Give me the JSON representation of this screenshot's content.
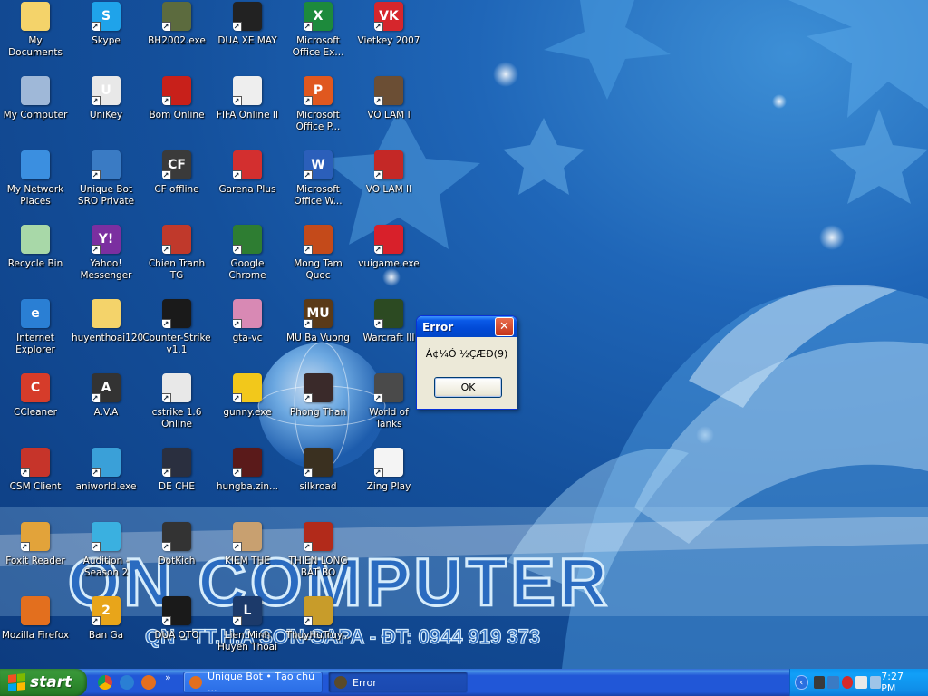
{
  "desktop": {
    "icons": [
      {
        "label": "My Documents",
        "name": "my-documents-icon",
        "glyph": "",
        "color": "#f4d36a",
        "shortcut": false
      },
      {
        "label": "Skype",
        "name": "skype-icon",
        "glyph": "S",
        "color": "#1fa3ea",
        "shortcut": true
      },
      {
        "label": "BH2002.exe",
        "name": "bh2002-icon",
        "glyph": "",
        "color": "#5c6b3e",
        "shortcut": true
      },
      {
        "label": "DUA XE MAY",
        "name": "dua-xe-may-icon",
        "glyph": "",
        "color": "#222222",
        "shortcut": true
      },
      {
        "label": "Microsoft Office Ex...",
        "name": "excel-icon",
        "glyph": "X",
        "color": "#1d8a3c",
        "shortcut": true
      },
      {
        "label": "Vietkey 2007",
        "name": "vietkey-icon",
        "glyph": "VK",
        "color": "#d6262c",
        "shortcut": true
      },
      {
        "label": "My Computer",
        "name": "my-computer-icon",
        "glyph": "",
        "color": "#9fb8d8",
        "shortcut": false
      },
      {
        "label": "UniKey",
        "name": "unikey-icon",
        "glyph": "U",
        "color": "#e8e8e8",
        "shortcut": true
      },
      {
        "label": "Bom Online",
        "name": "bom-online-icon",
        "glyph": "",
        "color": "#c8201a",
        "shortcut": true
      },
      {
        "label": "FIFA Online II",
        "name": "fifa-online-icon",
        "glyph": "",
        "color": "#eeeeee",
        "shortcut": true
      },
      {
        "label": "Microsoft Office P...",
        "name": "powerpoint-icon",
        "glyph": "P",
        "color": "#e0581f",
        "shortcut": true
      },
      {
        "label": "VO LAM I",
        "name": "vo-lam-1-icon",
        "glyph": "",
        "color": "#6b4e34",
        "shortcut": true
      },
      {
        "label": "My Network Places",
        "name": "network-places-icon",
        "glyph": "",
        "color": "#3b8fe0",
        "shortcut": false
      },
      {
        "label": "Unique Bot SRO Private",
        "name": "unique-bot-icon",
        "glyph": "",
        "color": "#3a7bc4",
        "shortcut": true
      },
      {
        "label": "CF offline",
        "name": "cf-offline-icon",
        "glyph": "CF",
        "color": "#3a3a3a",
        "shortcut": true
      },
      {
        "label": "Garena Plus",
        "name": "garena-plus-icon",
        "glyph": "",
        "color": "#d32f2f",
        "shortcut": true
      },
      {
        "label": "Microsoft Office W...",
        "name": "word-icon",
        "glyph": "W",
        "color": "#2b5fba",
        "shortcut": true
      },
      {
        "label": "VO LAM II",
        "name": "vo-lam-2-icon",
        "glyph": "",
        "color": "#c42826",
        "shortcut": true
      },
      {
        "label": "Recycle Bin",
        "name": "recycle-bin-icon",
        "glyph": "",
        "color": "#a8d8a8",
        "shortcut": false
      },
      {
        "label": "Yahoo! Messenger",
        "name": "yahoo-messenger-icon",
        "glyph": "Y!",
        "color": "#7b2fa0",
        "shortcut": true
      },
      {
        "label": "Chien Tranh TG",
        "name": "chien-tranh-icon",
        "glyph": "",
        "color": "#c0392b",
        "shortcut": true
      },
      {
        "label": "Google Chrome",
        "name": "chrome-icon",
        "glyph": "",
        "color": "#2e7d32",
        "shortcut": true
      },
      {
        "label": "Mong Tam Quoc",
        "name": "mong-tam-quoc-icon",
        "glyph": "",
        "color": "#c44a1a",
        "shortcut": true
      },
      {
        "label": "vuigame.exe",
        "name": "vuigame-icon",
        "glyph": "",
        "color": "#d8202a",
        "shortcut": true
      },
      {
        "label": "Internet Explorer",
        "name": "internet-explorer-icon",
        "glyph": "e",
        "color": "#2a7fd4",
        "shortcut": false
      },
      {
        "label": "huyenthoai120",
        "name": "folder-icon",
        "glyph": "",
        "color": "#f4d36a",
        "shortcut": false
      },
      {
        "label": "Counter-Strike v1.1",
        "name": "counter-strike-icon",
        "glyph": "",
        "color": "#1a1a1a",
        "shortcut": true
      },
      {
        "label": "gta-vc",
        "name": "gta-vc-icon",
        "glyph": "",
        "color": "#d889b4",
        "shortcut": true
      },
      {
        "label": "MU Ba Vuong",
        "name": "mu-ba-vuong-icon",
        "glyph": "MU",
        "color": "#5a3a18",
        "shortcut": true
      },
      {
        "label": "Warcraft III",
        "name": "warcraft-icon",
        "glyph": "",
        "color": "#2c4a22",
        "shortcut": true
      },
      {
        "label": "CCleaner",
        "name": "ccleaner-icon",
        "glyph": "C",
        "color": "#d63c2a",
        "shortcut": false
      },
      {
        "label": "A.V.A",
        "name": "ava-icon",
        "glyph": "A",
        "color": "#333333",
        "shortcut": true
      },
      {
        "label": "cstrike 1.6 Online",
        "name": "cstrike-icon",
        "glyph": "",
        "color": "#e8e8e8",
        "shortcut": true
      },
      {
        "label": "gunny.exe",
        "name": "gunny-icon",
        "glyph": "",
        "color": "#f2c81b",
        "shortcut": true
      },
      {
        "label": "Phong Than",
        "name": "phong-than-icon",
        "glyph": "",
        "color": "#3a2a2a",
        "shortcut": true
      },
      {
        "label": "World of Tanks",
        "name": "world-of-tanks-icon",
        "glyph": "",
        "color": "#4a4a4a",
        "shortcut": true
      },
      {
        "label": "CSM Client",
        "name": "csm-client-icon",
        "glyph": "",
        "color": "#c6342a",
        "shortcut": true
      },
      {
        "label": "aniworld.exe",
        "name": "aniworld-icon",
        "glyph": "",
        "color": "#3aa0d8",
        "shortcut": true
      },
      {
        "label": "DE CHE",
        "name": "de-che-icon",
        "glyph": "",
        "color": "#2a2f3f",
        "shortcut": true
      },
      {
        "label": "hungba.zin...",
        "name": "hungba-icon",
        "glyph": "",
        "color": "#5a1a1a",
        "shortcut": true
      },
      {
        "label": "silkroad",
        "name": "silkroad-icon",
        "glyph": "",
        "color": "#3a3020",
        "shortcut": true
      },
      {
        "label": "Zing Play",
        "name": "zing-play-icon",
        "glyph": "",
        "color": "#f4f4f4",
        "shortcut": true
      },
      {
        "label": "Foxit Reader",
        "name": "foxit-reader-icon",
        "glyph": "",
        "color": "#e2a33a",
        "shortcut": true
      },
      {
        "label": "Audition - Season 2",
        "name": "audition-icon",
        "glyph": "",
        "color": "#3ab0e0",
        "shortcut": true
      },
      {
        "label": "DotKich",
        "name": "dotkich-icon",
        "glyph": "",
        "color": "#333333",
        "shortcut": true
      },
      {
        "label": "KIEM THE",
        "name": "kiem-the-icon",
        "glyph": "",
        "color": "#c8a070",
        "shortcut": true
      },
      {
        "label": "THIEN LONG BAT BO",
        "name": "thien-long-icon",
        "glyph": "",
        "color": "#b22a1a",
        "shortcut": true
      },
      {
        "label": "Mozilla Firefox",
        "name": "firefox-icon",
        "glyph": "",
        "color": "#e36f1e",
        "shortcut": false
      },
      {
        "label": "Ban Ga",
        "name": "ban-ga-icon",
        "glyph": "2",
        "color": "#e8a51a",
        "shortcut": true
      },
      {
        "label": "DUA OTO",
        "name": "dua-oto-icon",
        "glyph": "",
        "color": "#1a1a1a",
        "shortcut": true
      },
      {
        "label": "Lien Minh Huyen Thoai",
        "name": "lien-minh-icon",
        "glyph": "L",
        "color": "#1c3a6a",
        "shortcut": true
      },
      {
        "label": "ThuyHuTruy...",
        "name": "thuyhu-icon",
        "glyph": "",
        "color": "#c89c2a",
        "shortcut": true
      }
    ]
  },
  "wallpaper": {
    "brand": "QN COMPUTER",
    "tagline": "QN - TT.H.A SƠN-SAPA - ĐT: 0944 919 373"
  },
  "dialog": {
    "title": "Error",
    "close_glyph": "✕",
    "message": "Á¢¼Ó ½ÇÆÐ(9)",
    "ok_label": "OK"
  },
  "taskbar": {
    "start_label": "start",
    "quick_launch_chevron": "»",
    "tasks": [
      {
        "label": "Unique Bot • Tạo chủ ...",
        "name": "task-unique-bot",
        "color": "#e36f1e",
        "active": false
      },
      {
        "label": "Error",
        "name": "task-error",
        "color": "#5a4a2a",
        "active": true
      }
    ],
    "tray_collapse": "‹",
    "clock": "7:27 PM"
  },
  "colors": {
    "taskbar_blue": "#2157d7",
    "start_green": "#2f8c2f",
    "dialog_bg": "#ece9d8",
    "titlebar_blue": "#0149d6"
  }
}
